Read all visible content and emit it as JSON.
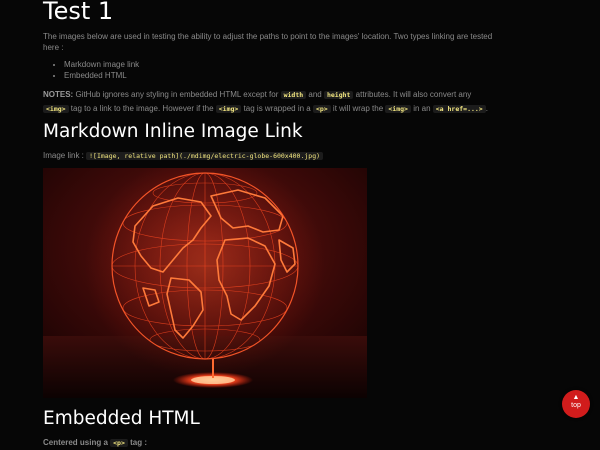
{
  "page": {
    "title": "Test 1",
    "intro": "The images below are used in testing the ability to adjust the paths to point to the images' location. Two types linking are tested here :",
    "list_items": [
      "Markdown image link",
      "Embedded HTML"
    ],
    "notes": {
      "label": "NOTES:",
      "t1": " GitHub ignores any styling in embedded HTML except for ",
      "c1": "width",
      "t2": " and ",
      "c2": "height",
      "t3": " attributes. It will also convert any ",
      "c3": "<img>",
      "t4": " tag to a link to the image. However if the ",
      "c4": "<img>",
      "t5": " tag is wrapped in a ",
      "c5": "<p>",
      "t6": " it will wrap the ",
      "c6": "<img>",
      "t7": " in an ",
      "c7": "<a href=...>",
      "t8": "."
    }
  },
  "section_markdown": {
    "heading": "Markdown Inline Image Link",
    "image_link_label": "Image link : ",
    "image_link_code": "![Image, relative path](./mdimg/electric-globe-600x400.jpg)"
  },
  "section_embedded": {
    "heading": "Embedded HTML",
    "centered_label": "Centered using a ",
    "centered_code": "<p>",
    "centered_suffix": " tag :"
  },
  "top_button": {
    "arrow": "▲",
    "label": "top"
  },
  "colors": {
    "background": "#060606",
    "heading": "#ffffff",
    "code_text": "#f2e680",
    "top_button": "#d11c1c"
  }
}
